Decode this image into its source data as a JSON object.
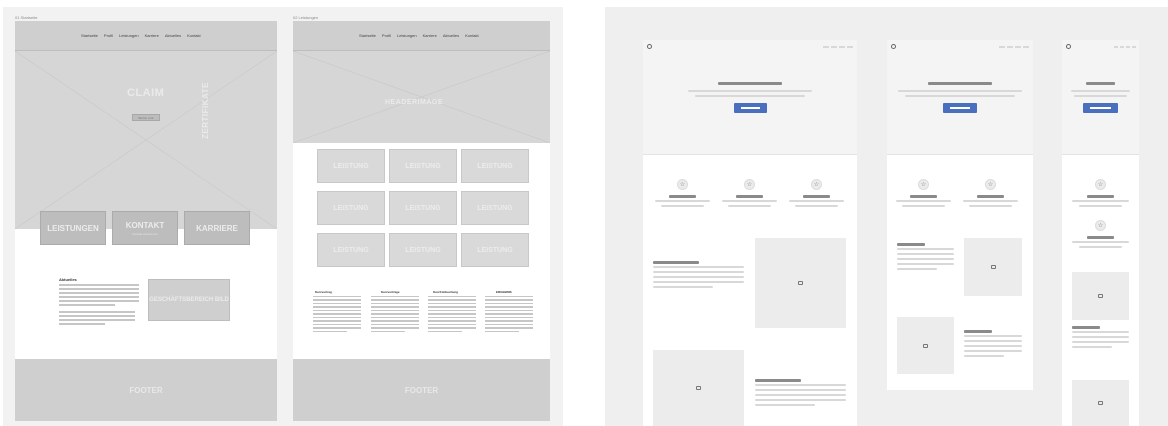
{
  "wireframes": {
    "startseite": {
      "frame_label": "01 Startseite",
      "nav": [
        "Startseite",
        "Profil",
        "Leistungen",
        "Karriere",
        "Aktuelles",
        "Kontakt"
      ],
      "claim": "CLAIM",
      "claim_button": "Button Link",
      "zertifikate": "ZERTIFIKATE",
      "tiles": [
        {
          "label": "LEISTUNGEN",
          "sub": ""
        },
        {
          "label": "KONTAKT",
          "sub": "Kontakt aufnehmen"
        },
        {
          "label": "KARRIERE",
          "sub": ""
        }
      ],
      "aktuelles_heading": "Aktuelles",
      "geschaeft_bild": "GESCHÄFTSBEREICH BILD",
      "footer": "FOOTER"
    },
    "leistungen": {
      "frame_label": "02 Leistungen",
      "nav": [
        "Startseite",
        "Profil",
        "Leistungen",
        "Karriere",
        "Aktuelles",
        "Kontakt"
      ],
      "headerimage": "HEADERIMAGE",
      "tiles": [
        "LEISTUNG",
        "LEISTUNG",
        "LEISTUNG",
        "LEISTUNG",
        "LEISTUNG",
        "LEISTUNG",
        "LEISTUNG",
        "LEISTUNG",
        "LEISTUNG"
      ],
      "columns": [
        "Kurzvertrag",
        "Kurzverträge",
        "Kurzfristbuchung",
        "ERGEBNIS"
      ],
      "footer": "FOOTER"
    }
  },
  "mockups": {
    "desktop": {
      "feature_icon": "☆",
      "features": 3
    },
    "tablet": {
      "feature_icon": "☆",
      "features": 2
    },
    "mobile": {
      "feature_icon": "☆",
      "features": 2
    }
  },
  "colors": {
    "cta_blue": "#4a6fbf",
    "wireframe_gray": "#d6d6d6",
    "panel_bg": "#f2f2f2"
  }
}
